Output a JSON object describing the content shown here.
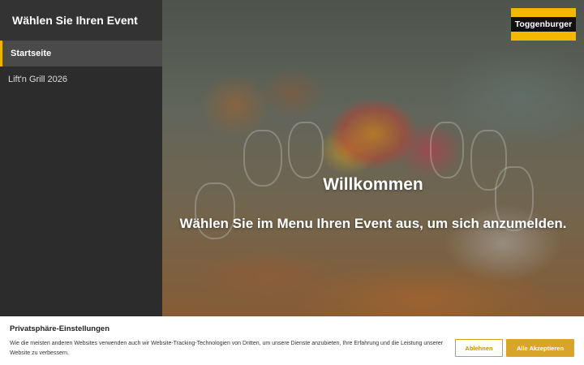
{
  "sidebar": {
    "title": "Wählen Sie Ihren Event",
    "items": [
      {
        "label": "Startseite",
        "active": true
      },
      {
        "label": "Lift'n Grill 2026",
        "active": false
      }
    ]
  },
  "hero": {
    "title": "Willkommen",
    "subtitle": "Wählen Sie im Menu Ihren Event aus, um sich anzumelden."
  },
  "logo": {
    "text": "Toggenburger",
    "brand_color": "#f5b800"
  },
  "cookie_banner": {
    "title": "Privatsphäre-Einstellungen",
    "text": "Wie die meisten anderen Websites verwenden auch wir Website-Tracking-Technologien von Dritten, um unsere Dienste anzubieten, Ihre Erfahrung und die Leistung unserer Website zu verbessern.",
    "decline_label": "Ablehnen",
    "accept_label": "Alle Akzeptieren",
    "accent_color": "#d8a52a"
  }
}
